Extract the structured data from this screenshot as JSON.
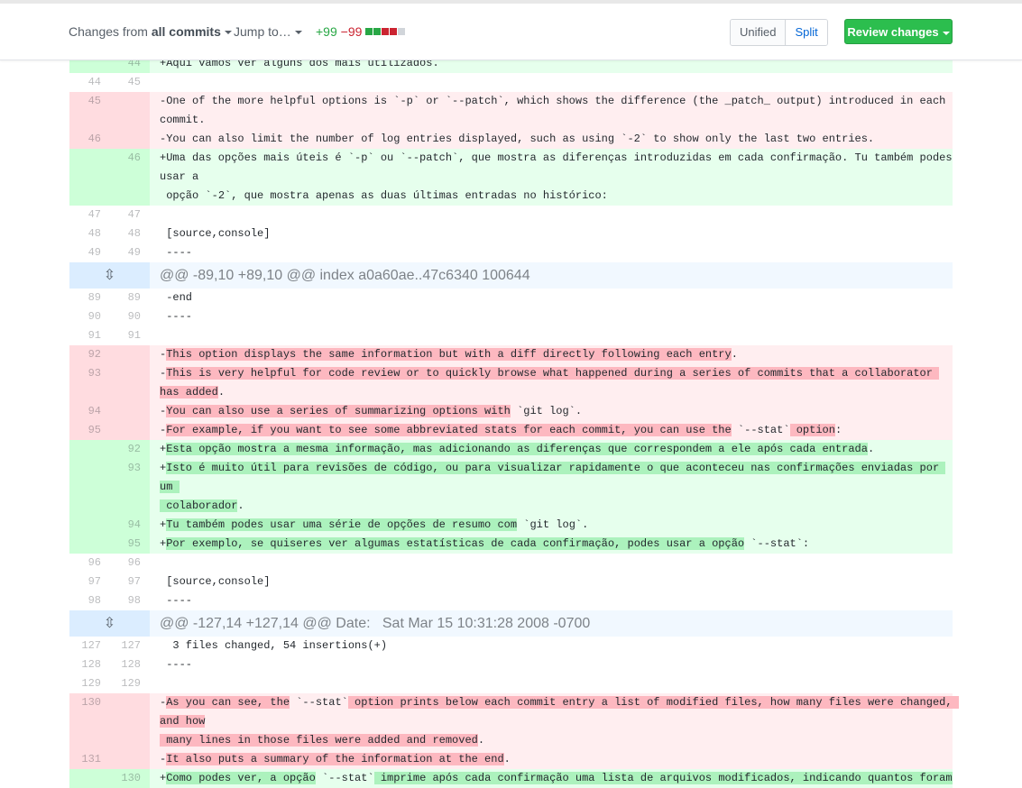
{
  "toolbar": {
    "changes_prefix": "Changes from ",
    "changes_value": "all commits",
    "jump_label": "Jump to…",
    "additions": "+99",
    "deletions": "−99",
    "unified_label": "Unified",
    "split_label": "Split",
    "review_label": "Review changes"
  },
  "colors": {
    "addition": "#28a745",
    "deletion": "#cb2431",
    "review_button": "#2cbe4e",
    "link": "#0366d6"
  },
  "hunks": {
    "h1": "@@ -89,10 +89,10 @@ index a0a60ae..47c6340 100644",
    "h2": "@@ -127,14 +127,14 @@ Date:   Sat Mar 15 10:31:28 2008 -0700"
  },
  "rows": {
    "r1": {
      "o": "",
      "n": "44",
      "t": "+Aqui vamos ver alguns dos mais utilizados."
    },
    "r2": {
      "o": "44",
      "n": "45",
      "t": " "
    },
    "r3": {
      "o": "45",
      "n": "",
      "t": "-One of the more helpful options is `-p` or `--patch`, which shows the difference (the _patch_ output) introduced in each commit."
    },
    "r4": {
      "o": "46",
      "n": "",
      "t": "-You can also limit the number of log entries displayed, such as using `-2` to show only the last two entries."
    },
    "r5": {
      "o": "",
      "n": "46",
      "t": "+Uma das opções mais úteis é `-p` ou `--patch`, que mostra as diferenças introduzidas em cada confirmação. Tu também podes usar a\n opção `-2`, que mostra apenas as duas últimas entradas no histórico:"
    },
    "r6": {
      "o": "47",
      "n": "47",
      "t": " "
    },
    "r7": {
      "o": "48",
      "n": "48",
      "t": " [source,console]"
    },
    "r8": {
      "o": "49",
      "n": "49",
      "t": " ----"
    },
    "r9": {
      "o": "89",
      "n": "89",
      "t": " -end"
    },
    "r10": {
      "o": "90",
      "n": "90",
      "t": " ----"
    },
    "r11": {
      "o": "91",
      "n": "91",
      "t": " "
    },
    "r12": {
      "o": "92",
      "n": "",
      "pre": "-",
      "hl": "This option displays the same information but with a diff directly following each entry",
      "post": "."
    },
    "r13": {
      "o": "93",
      "n": "",
      "pre": "-",
      "hl": "This is very helpful for code review or to quickly browse what happened during a series of commits that a collaborator has added",
      "post": "."
    },
    "r14": {
      "o": "94",
      "n": "",
      "pre": "-",
      "hl": "You can also use a series of summarizing options with",
      "post": " `git log`."
    },
    "r15": {
      "o": "95",
      "n": "",
      "pre": "-",
      "hl": "For example, if you want to see some abbreviated stats for each commit, you can use the",
      "mid": " `--stat`",
      "hl2": " option",
      "post": ":"
    },
    "r16": {
      "o": "",
      "n": "92",
      "pre": "+",
      "hl": "Esta opção mostra a mesma informação, mas adicionando as diferenças que correspondem a ele após cada entrada",
      "post": "."
    },
    "r17": {
      "o": "",
      "n": "93",
      "pre": "+",
      "hl": "Isto é muito útil para revisões de código, ou para visualizar rapidamente o que aconteceu nas confirmações enviadas por um \n colaborador",
      "post": "."
    },
    "r18": {
      "o": "",
      "n": "94",
      "pre": "+",
      "hl": "Tu também podes usar uma série de opções de resumo com",
      "post": " `git log`."
    },
    "r19": {
      "o": "",
      "n": "95",
      "pre": "+",
      "hl": "Por exemplo, se quiseres ver algumas estatísticas de cada confirmação, podes usar a opção",
      "post": " `--stat`:"
    },
    "r20": {
      "o": "96",
      "n": "96",
      "t": " "
    },
    "r21": {
      "o": "97",
      "n": "97",
      "t": " [source,console]"
    },
    "r22": {
      "o": "98",
      "n": "98",
      "t": " ----"
    },
    "r23": {
      "o": "127",
      "n": "127",
      "t": "  3 files changed, 54 insertions(+)"
    },
    "r24": {
      "o": "128",
      "n": "128",
      "t": " ----"
    },
    "r25": {
      "o": "129",
      "n": "129",
      "t": " "
    },
    "r26": {
      "o": "130",
      "n": "",
      "pre": "-",
      "hl": "As you can see, the",
      "mid": " `--stat`",
      "hl2": " option prints below each commit entry a list of modified files, how many files were changed, and how\n many lines in those files were added and removed",
      "post": "."
    },
    "r27": {
      "o": "131",
      "n": "",
      "pre": "-",
      "hl": "It also puts a summary of the information at the end",
      "post": "."
    },
    "r28": {
      "o": "",
      "n": "130",
      "pre": "+",
      "hl": "Como podes ver, a opção",
      "mid": " `--stat`",
      "hl2": " imprime após cada confirmação uma lista de arquivos modificados, indicando quantos foram",
      "post": ""
    }
  }
}
